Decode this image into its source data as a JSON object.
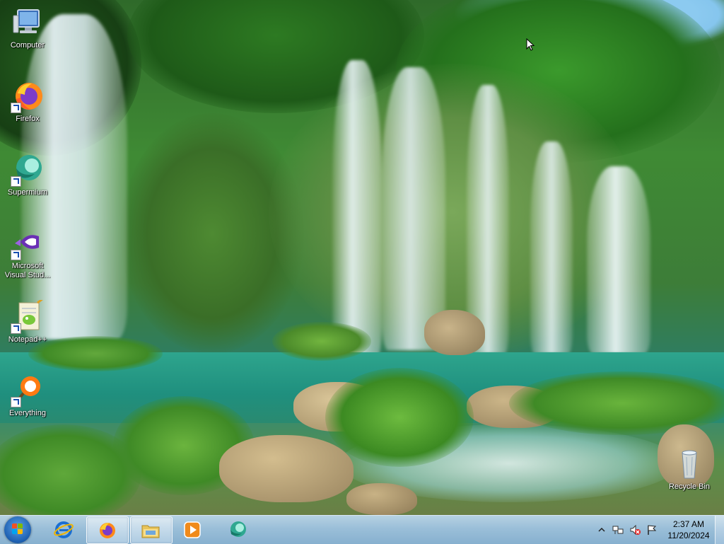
{
  "desktop": {
    "icons": [
      {
        "label": "Computer"
      },
      {
        "label": "Firefox"
      },
      {
        "label": "Supermium"
      },
      {
        "label": "Microsoft Visual Stud..."
      },
      {
        "label": "Notepad++"
      },
      {
        "label": "Everything"
      },
      {
        "label": "Recycle Bin"
      }
    ]
  },
  "taskbar": {
    "start_icon": "windows-logo-icon",
    "pinned": [
      {
        "app": "Internet Explorer",
        "icon": "internet-explorer-icon"
      },
      {
        "app": "Firefox",
        "icon": "firefox-icon",
        "active": true
      },
      {
        "app": "Windows Explorer",
        "icon": "folder-icon",
        "active": true
      },
      {
        "app": "Windows Media Player",
        "icon": "media-player-icon"
      },
      {
        "app": "Supermium",
        "icon": "supermium-icon"
      }
    ],
    "tray": {
      "icons": [
        "show-hidden-icons-chevron",
        "network-icon",
        "volume-muted-icon",
        "action-center-flag-icon"
      ],
      "time": "2:37 AM",
      "date": "11/20/2024"
    }
  },
  "colors": {
    "taskbar": "#a8c8e4",
    "start_orb": "#1d5fb0",
    "label_text": "#ffffff"
  }
}
